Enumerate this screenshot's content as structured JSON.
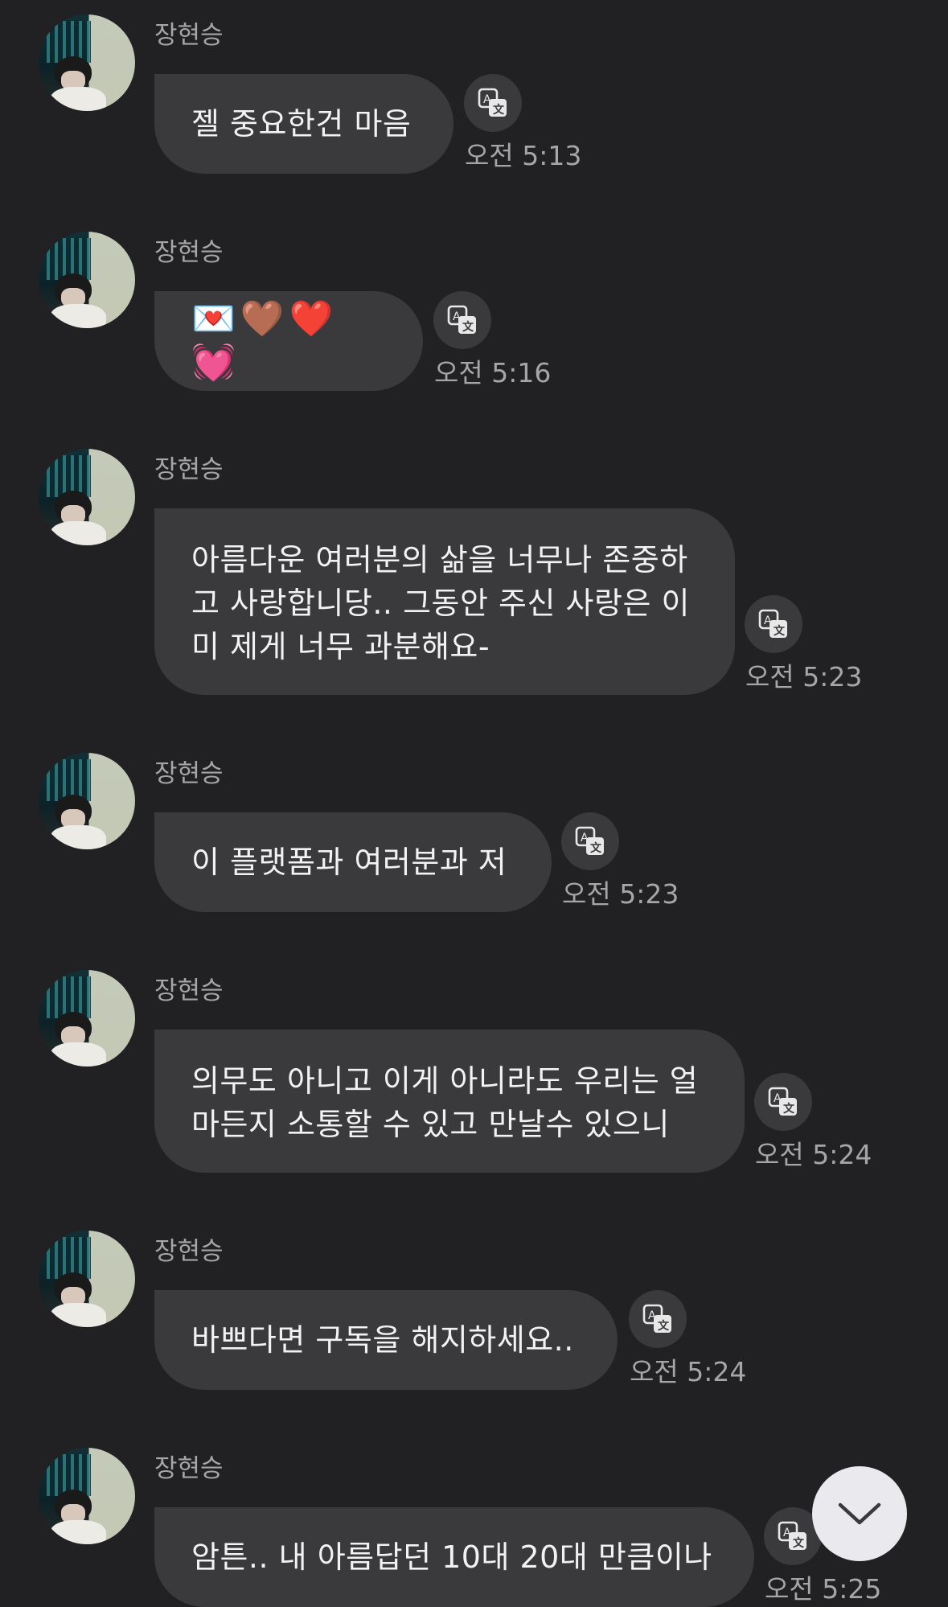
{
  "messages": [
    {
      "sender": "장현승",
      "text": "젤 중요한건 마음",
      "time": "오전 5:13"
    },
    {
      "sender": "장현승",
      "text": "💌🤎❤️💓",
      "time": "오전 5:16"
    },
    {
      "sender": "장현승",
      "text": "아름다운 여러분의 삶을 너무나 존중하\n고 사랑합니당.. 그동안 주신 사랑은 이\n미 제게 너무 과분해요-",
      "time": "오전 5:23"
    },
    {
      "sender": "장현승",
      "text": "이 플랫폼과 여러분과 저",
      "time": "오전 5:23"
    },
    {
      "sender": "장현승",
      "text": "의무도 아니고 이게 아니라도 우리는 얼\n마든지 소통할 수 있고 만날수 있으니",
      "time": "오전 5:24"
    },
    {
      "sender": "장현승",
      "text": "바쁘다면 구독을 해지하세요..",
      "time": "오전 5:24"
    },
    {
      "sender": "장현승",
      "text": "암튼.. 내 아름답던 10대 20대 만큼이나",
      "time": "오전 5:25"
    }
  ],
  "icons": {
    "avatar": "profile-photo",
    "translate": "translate-icon",
    "scroll": "chevron-down-icon"
  },
  "colors": {
    "background": "#212123",
    "bubble": "#3a3a3c",
    "secondary_text": "#a5a5aa",
    "scroll_button": "#e9e9ee"
  }
}
